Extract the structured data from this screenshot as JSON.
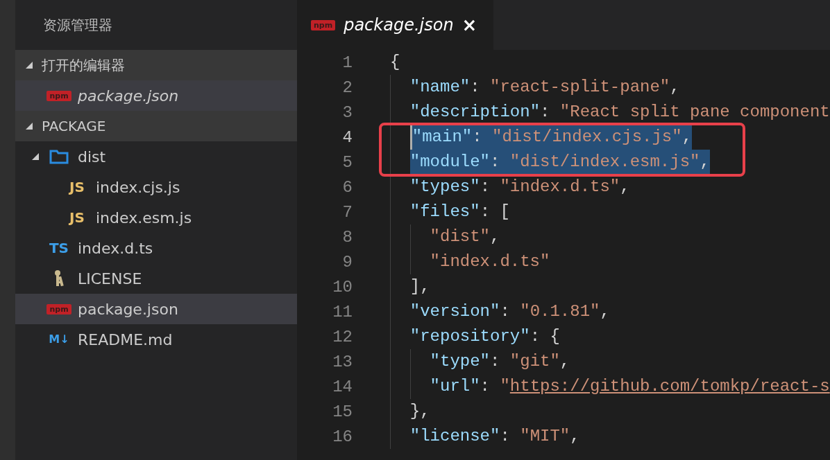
{
  "sidebar": {
    "title": "资源管理器",
    "sections": [
      {
        "title": "打开的编辑器",
        "expanded": true,
        "items": [
          {
            "name": "package.json",
            "icon": {
              "kind": "npm",
              "glyph": "npm"
            },
            "preview": true,
            "selected": true
          }
        ]
      },
      {
        "title": "PACKAGE",
        "expanded": true,
        "items": [
          {
            "name": "dist",
            "icon": {
              "kind": "folder"
            },
            "expanded": true,
            "selected": false,
            "children": [
              {
                "name": "index.cjs.js",
                "icon": {
                  "kind": "js",
                  "glyph": "JS"
                },
                "selected": false
              },
              {
                "name": "index.esm.js",
                "icon": {
                  "kind": "js",
                  "glyph": "JS"
                },
                "selected": false
              }
            ]
          },
          {
            "name": "index.d.ts",
            "icon": {
              "kind": "ts",
              "glyph": "TS"
            },
            "selected": false
          },
          {
            "name": "LICENSE",
            "icon": {
              "kind": "license"
            },
            "selected": false
          },
          {
            "name": "package.json",
            "icon": {
              "kind": "npm",
              "glyph": "npm"
            },
            "selected": true
          },
          {
            "name": "README.md",
            "icon": {
              "kind": "markdown",
              "glyph": "M↓"
            },
            "selected": false
          }
        ]
      }
    ]
  },
  "tabs": [
    {
      "label": "package.json",
      "icon": {
        "kind": "npm",
        "glyph": "npm"
      },
      "preview": true,
      "selected": true,
      "close": "×"
    }
  ],
  "editor": {
    "annotation": {
      "kind": "box"
    },
    "lines": [
      {
        "number": "1",
        "selected": false,
        "current": false,
        "tokens": [
          {
            "kind": "punct",
            "text": "{"
          }
        ],
        "children": [
          {
            "number": "2",
            "selected": false,
            "current": false,
            "tokens": [
              {
                "kind": "key",
                "text": "\"name\""
              },
              {
                "kind": "punct",
                "text": ": "
              },
              {
                "kind": "string",
                "text": "\"react-split-pane\""
              },
              {
                "kind": "punct",
                "text": ","
              }
            ]
          },
          {
            "number": "3",
            "selected": false,
            "current": false,
            "tokens": [
              {
                "kind": "key",
                "text": "\"description\""
              },
              {
                "kind": "punct",
                "text": ": "
              },
              {
                "kind": "string",
                "text": "\"React split pane component"
              }
            ]
          },
          {
            "number": "4",
            "selected": true,
            "current": true,
            "tokens": [
              {
                "kind": "key",
                "text": "\"main\""
              },
              {
                "kind": "punct",
                "text": ": "
              },
              {
                "kind": "string",
                "text": "\"dist/index.cjs.js\""
              },
              {
                "kind": "punct",
                "text": ","
              }
            ]
          },
          {
            "number": "5",
            "selected": true,
            "current": false,
            "tokens": [
              {
                "kind": "key",
                "text": "\"module\""
              },
              {
                "kind": "punct",
                "text": ": "
              },
              {
                "kind": "string",
                "text": "\"dist/index.esm.js\""
              },
              {
                "kind": "punct",
                "text": ","
              }
            ]
          },
          {
            "number": "6",
            "selected": false,
            "current": false,
            "tokens": [
              {
                "kind": "key",
                "text": "\"types\""
              },
              {
                "kind": "punct",
                "text": ": "
              },
              {
                "kind": "string",
                "text": "\"index.d.ts\""
              },
              {
                "kind": "punct",
                "text": ","
              }
            ]
          },
          {
            "number": "7",
            "selected": false,
            "current": false,
            "tokens": [
              {
                "kind": "key",
                "text": "\"files\""
              },
              {
                "kind": "punct",
                "text": ": ["
              }
            ],
            "children": [
              {
                "number": "8",
                "selected": false,
                "current": false,
                "tokens": [
                  {
                    "kind": "string",
                    "text": "\"dist\""
                  },
                  {
                    "kind": "punct",
                    "text": ","
                  }
                ]
              },
              {
                "number": "9",
                "selected": false,
                "current": false,
                "tokens": [
                  {
                    "kind": "string",
                    "text": "\"index.d.ts\""
                  }
                ]
              }
            ]
          },
          {
            "number": "10",
            "selected": false,
            "current": false,
            "tokens": [
              {
                "kind": "punct",
                "text": "],"
              }
            ]
          },
          {
            "number": "11",
            "selected": false,
            "current": false,
            "tokens": [
              {
                "kind": "key",
                "text": "\"version\""
              },
              {
                "kind": "punct",
                "text": ": "
              },
              {
                "kind": "string",
                "text": "\"0.1.81\""
              },
              {
                "kind": "punct",
                "text": ","
              }
            ]
          },
          {
            "number": "12",
            "selected": false,
            "current": false,
            "tokens": [
              {
                "kind": "key",
                "text": "\"repository\""
              },
              {
                "kind": "punct",
                "text": ": {"
              }
            ],
            "children": [
              {
                "number": "13",
                "selected": false,
                "current": false,
                "tokens": [
                  {
                    "kind": "key",
                    "text": "\"type\""
                  },
                  {
                    "kind": "punct",
                    "text": ": "
                  },
                  {
                    "kind": "string",
                    "text": "\"git\""
                  },
                  {
                    "kind": "punct",
                    "text": ","
                  }
                ]
              },
              {
                "number": "14",
                "selected": false,
                "current": false,
                "tokens": [
                  {
                    "kind": "key",
                    "text": "\"url\""
                  },
                  {
                    "kind": "punct",
                    "text": ": "
                  },
                  {
                    "kind": "string",
                    "text": "\""
                  },
                  {
                    "kind": "link",
                    "text": "https://github.com/tomkp/react-s"
                  }
                ]
              }
            ]
          },
          {
            "number": "15",
            "selected": false,
            "current": false,
            "tokens": [
              {
                "kind": "punct",
                "text": "},"
              }
            ]
          },
          {
            "number": "16",
            "selected": false,
            "current": false,
            "tokens": [
              {
                "kind": "key",
                "text": "\"license\""
              },
              {
                "kind": "punct",
                "text": ": "
              },
              {
                "kind": "string",
                "text": "\"MIT\""
              },
              {
                "kind": "punct",
                "text": ","
              }
            ]
          }
        ]
      }
    ]
  }
}
